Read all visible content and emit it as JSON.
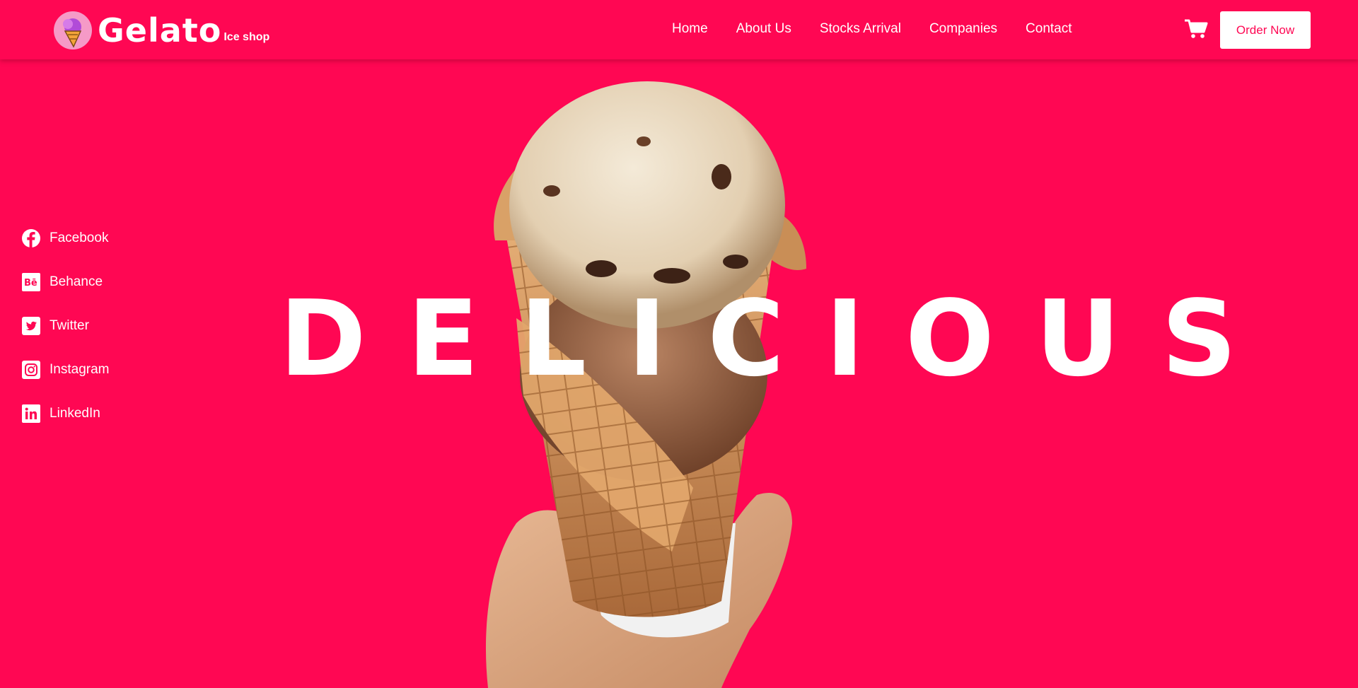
{
  "brand": {
    "name": "Gelato",
    "tagline": "Ice shop"
  },
  "nav": {
    "items": [
      "Home",
      "About Us",
      "Stocks Arrival",
      "Companies",
      "Contact"
    ]
  },
  "header": {
    "order_label": "Order Now",
    "cart_icon": "cart-icon"
  },
  "social": [
    {
      "label": "Facebook",
      "icon": "facebook-icon"
    },
    {
      "label": "Behance",
      "icon": "behance-icon"
    },
    {
      "label": "Twitter",
      "icon": "twitter-icon"
    },
    {
      "label": "Instagram",
      "icon": "instagram-icon"
    },
    {
      "label": "LinkedIn",
      "icon": "linkedin-icon"
    }
  ],
  "hero": {
    "title": "DELICIOUS",
    "image": "ice-cream-cone-in-hand"
  },
  "colors": {
    "background": "#ff0753",
    "text": "#ffffff",
    "button_bg": "#ffffff",
    "button_text": "#ff0753"
  }
}
